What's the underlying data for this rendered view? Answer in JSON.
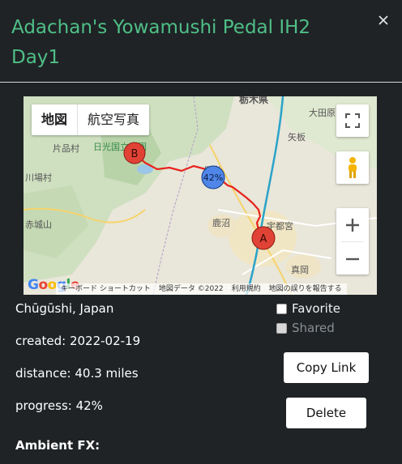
{
  "dialog": {
    "title": "Adachan's Yowamushi Pedal IH2 Day1",
    "close_icon": "close-icon"
  },
  "map": {
    "tabs": [
      {
        "label": "地図",
        "active": true
      },
      {
        "label": "航空写真",
        "active": false
      }
    ],
    "labels": {
      "tochigi": "栃木県",
      "otawara": "大田原",
      "yaita": "矢板",
      "katashina": "片品村",
      "nikko_park": "日光国立公園",
      "nikko": "日光",
      "kanuma": "鹿沼",
      "utsunomiya": "宇都宮",
      "kawaba": "川場村",
      "akagi": "赤城山",
      "moka": "真岡"
    },
    "markers": {
      "start": "A",
      "end": "B",
      "progress": "42%"
    },
    "attribution": {
      "google": "Google",
      "keyboard": "キーボード ショートカット",
      "map_data": "地図データ ©2022",
      "terms": "利用規約",
      "report": "地図の誤りを報告する"
    },
    "colors": {
      "route": "#e8211b",
      "highway": "#2aa3c9",
      "marker": "#e04335",
      "progress": "#4f86e8"
    }
  },
  "ride": {
    "location": "Chūgūshi, Japan",
    "created": "created: 2022-02-19",
    "distance": "distance: 40.3 miles",
    "progress": "progress: 42%"
  },
  "options": {
    "favorite": "Favorite",
    "shared": "Shared"
  },
  "actions": {
    "copy_link": "Copy Link",
    "delete": "Delete"
  },
  "section": {
    "ambient": "Ambient FX:"
  }
}
